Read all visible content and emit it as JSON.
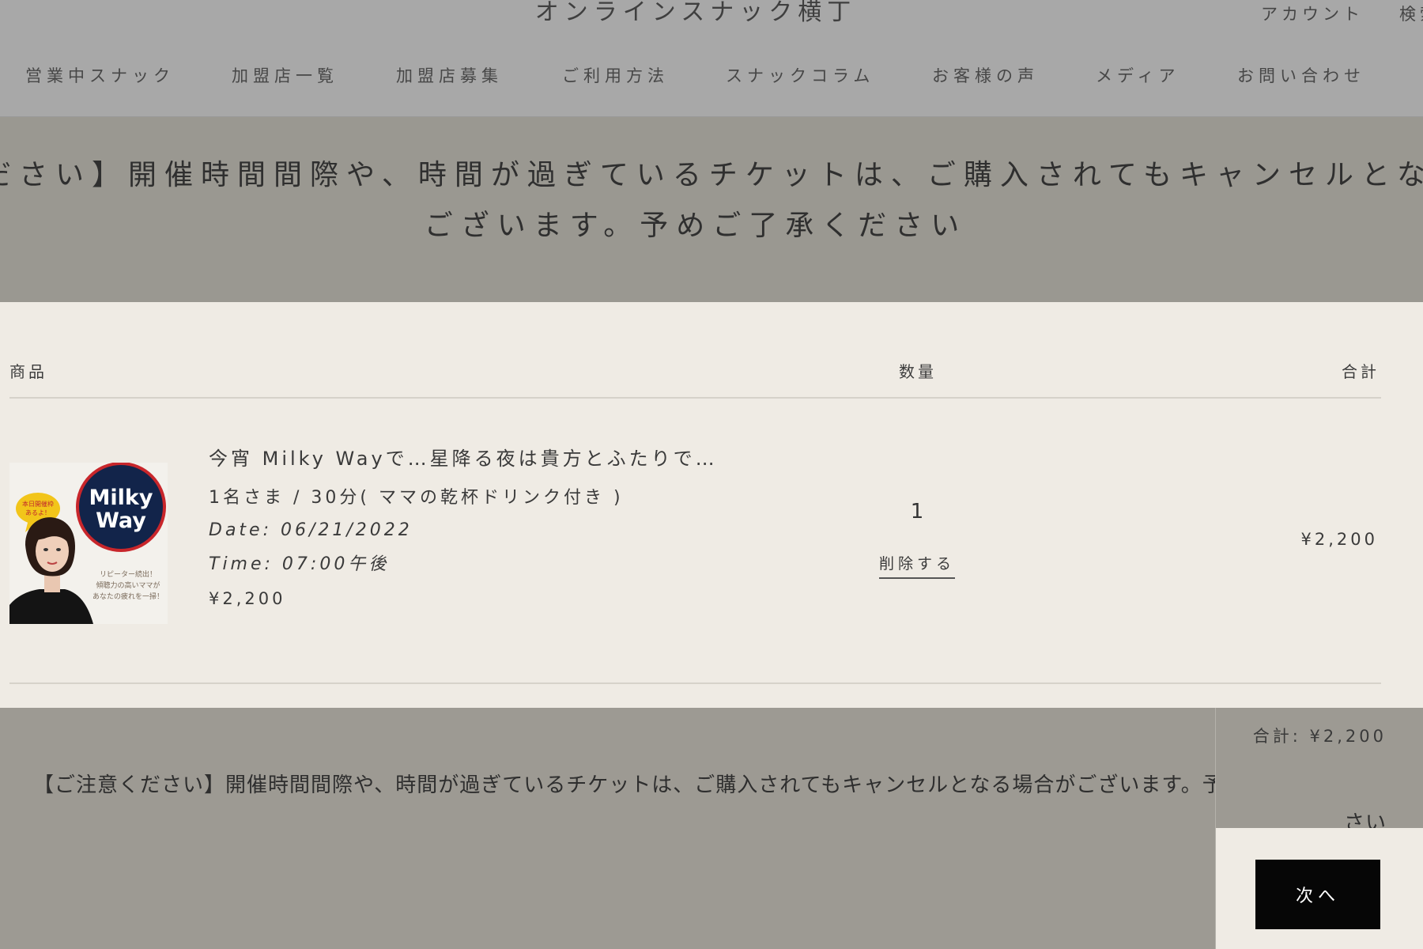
{
  "header": {
    "site_title": "オンラインスナック横丁",
    "account_link": "アカウント",
    "search_link": "検索",
    "nav": [
      "営業中スナック",
      "加盟店一覧",
      "加盟店募集",
      "ご利用方法",
      "スナックコラム",
      "お客様の声",
      "メディア",
      "お問い合わせ"
    ]
  },
  "notice_band": {
    "line1": "ださい】開催時間間際や、時間が過ぎているチケットは、ご購入されてもキャンセルとな",
    "line2": "ございます。予めご了承ください"
  },
  "cart": {
    "columns": {
      "product": "商品",
      "quantity": "数量",
      "total": "合計"
    },
    "items": [
      {
        "thumbnail_icon": "milky-way-snack-thumbnail",
        "badge_text": "本日開催枠あるよ！",
        "logo_line1": "Milky",
        "logo_line2": "Way",
        "caption_line1": "リピーター続出！",
        "caption_line2": "傾聴力の高いママが",
        "caption_line3": "あなたの疲れを一掃！",
        "name": "今宵 Milky Wayで…星降る夜は貴方とふたりで…",
        "variant": "1名さま / 30分( ママの乾杯ドリンク付き )",
        "date": "Date: 06/21/2022",
        "time": "Time: 07:00午後",
        "price": "¥2,200",
        "quantity": "1",
        "remove_label": "削除する",
        "line_total": "¥2,200"
      }
    ]
  },
  "footer": {
    "notice": "【ご注意ください】開催時間間際や、時間が過ぎているチケットは、ご購入されてもキャンセルとなる場合がございます。予めご了承くだ",
    "notice_end": "さい",
    "subtotal": "合計: ¥2,200",
    "next_button": "次へ"
  },
  "colors": {
    "header_bg": "#a8a8a8",
    "band_bg": "#9a9891",
    "page_bg": "#efebe4",
    "button_bg": "#060606"
  }
}
